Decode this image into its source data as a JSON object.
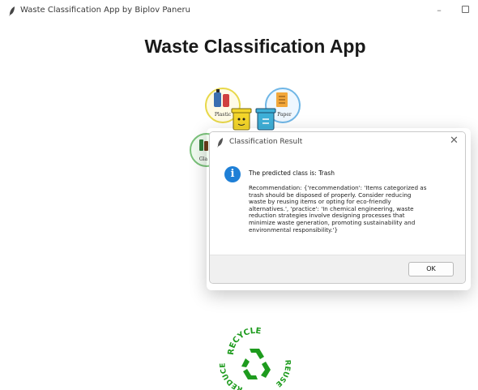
{
  "window": {
    "title": "Waste Classification App by Biplov Paneru",
    "minimize_glyph": "–",
    "icon": "feather-icon"
  },
  "app": {
    "heading": "Waste Classification App",
    "bins": {
      "plastic_label": "Plastic",
      "paper_label": "Paper",
      "glass_label": "Gla"
    },
    "recycle_logo": {
      "top_text": "RECYCLE",
      "left_text": "REDUCE",
      "right_text": "REUSE",
      "color": "#1e9b1e"
    }
  },
  "dialog": {
    "title": "Classification Result",
    "close_glyph": "✕",
    "info_glyph": "i",
    "main_text": "The predicted class is: Trash",
    "detail_lines": [
      "Recommendation: {'recommendation': 'Items categorized as",
      "trash should be disposed of properly. Consider reducing",
      "waste by reusing items or opting for eco-friendly",
      "alternatives.', 'practice': 'In chemical engineering, waste",
      "reduction strategies involve designing processes that",
      "minimize waste generation, promoting sustainability and",
      "environmental responsibility.'}"
    ],
    "ok_label": "OK"
  },
  "colors": {
    "info_blue": "#1e7fd6",
    "recycle_green": "#1e9b1e",
    "plastic_circle": "#e8d84a",
    "paper_circle": "#6fb6e6",
    "glass_circle": "#7ac27a"
  }
}
